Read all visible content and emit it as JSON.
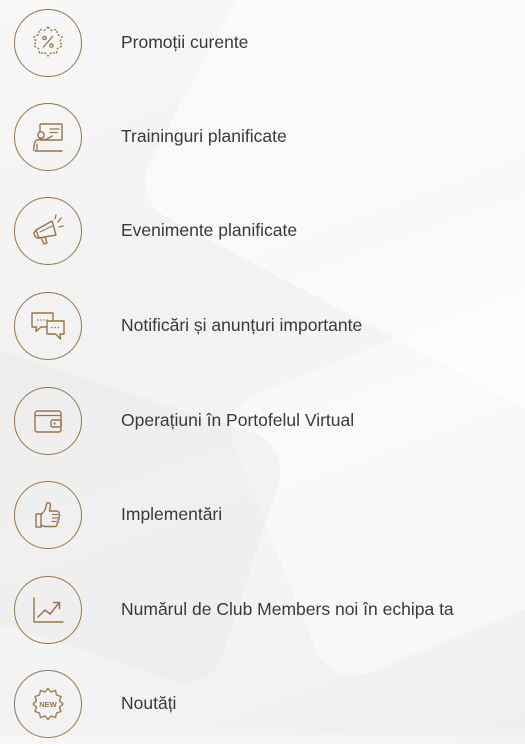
{
  "accent_color": "#9a7548",
  "text_color": "#3a3a3a",
  "items": [
    {
      "icon": "percent-badge-icon",
      "label": "Promoții curente"
    },
    {
      "icon": "presentation-board-icon",
      "label": "Traininguri planificate"
    },
    {
      "icon": "megaphone-icon",
      "label": "Evenimente planificate"
    },
    {
      "icon": "chat-bubbles-icon",
      "label": "Notificări și anunțuri importante"
    },
    {
      "icon": "wallet-icon",
      "label": "Operațiuni în Portofelul Virtual"
    },
    {
      "icon": "thumbs-up-icon",
      "label": "Implementări"
    },
    {
      "icon": "growth-chart-icon",
      "label": "Numărul de Club Members noi în echipa ta"
    },
    {
      "icon": "new-badge-icon",
      "label": "Noutăți",
      "badge_text": "NEW"
    }
  ]
}
